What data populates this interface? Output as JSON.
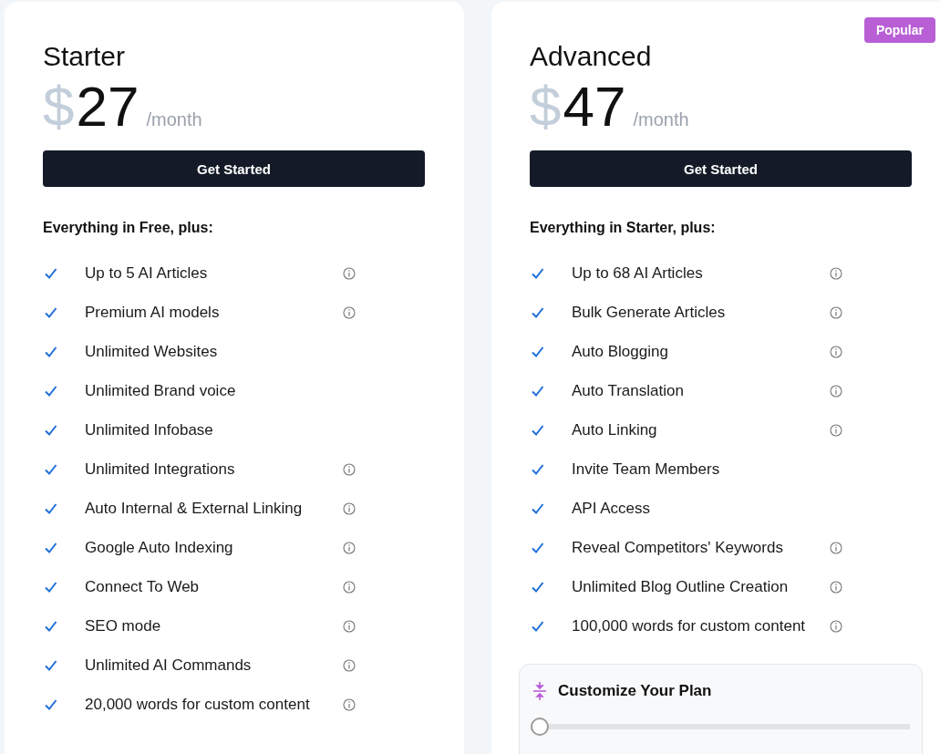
{
  "plans": [
    {
      "name": "Starter",
      "currency": "$",
      "price": "27",
      "period": "/month",
      "button": "Get Started",
      "features_heading": "Everything in Free, plus:",
      "features": [
        {
          "label": "Up to 5 AI Articles",
          "info": true
        },
        {
          "label": "Premium AI models",
          "info": true
        },
        {
          "label": "Unlimited Websites",
          "info": false
        },
        {
          "label": "Unlimited Brand voice",
          "info": false
        },
        {
          "label": "Unlimited Infobase",
          "info": false
        },
        {
          "label": "Unlimited Integrations",
          "info": true
        },
        {
          "label": "Auto Internal & External Linking",
          "info": true
        },
        {
          "label": "Google Auto Indexing",
          "info": true
        },
        {
          "label": "Connect To Web",
          "info": true
        },
        {
          "label": "SEO mode",
          "info": true
        },
        {
          "label": "Unlimited AI Commands",
          "info": true
        },
        {
          "label": "20,000 words for custom content",
          "info": true
        }
      ]
    },
    {
      "name": "Advanced",
      "currency": "$",
      "price": "47",
      "period": "/month",
      "button": "Get Started",
      "badge": "Popular",
      "features_heading": "Everything in Starter, plus:",
      "features": [
        {
          "label": "Up to 68 AI Articles",
          "info": true
        },
        {
          "label": "Bulk Generate Articles",
          "info": true
        },
        {
          "label": "Auto Blogging",
          "info": true
        },
        {
          "label": "Auto Translation",
          "info": true
        },
        {
          "label": "Auto Linking",
          "info": true
        },
        {
          "label": "Invite Team Members",
          "info": false
        },
        {
          "label": "API Access",
          "info": false
        },
        {
          "label": "Reveal Competitors' Keywords",
          "info": true
        },
        {
          "label": "Unlimited Blog Outline Creation",
          "info": true
        },
        {
          "label": "100,000 words for custom content",
          "info": true
        }
      ],
      "customize": {
        "title": "Customize Your Plan",
        "level": 0
      }
    }
  ]
}
